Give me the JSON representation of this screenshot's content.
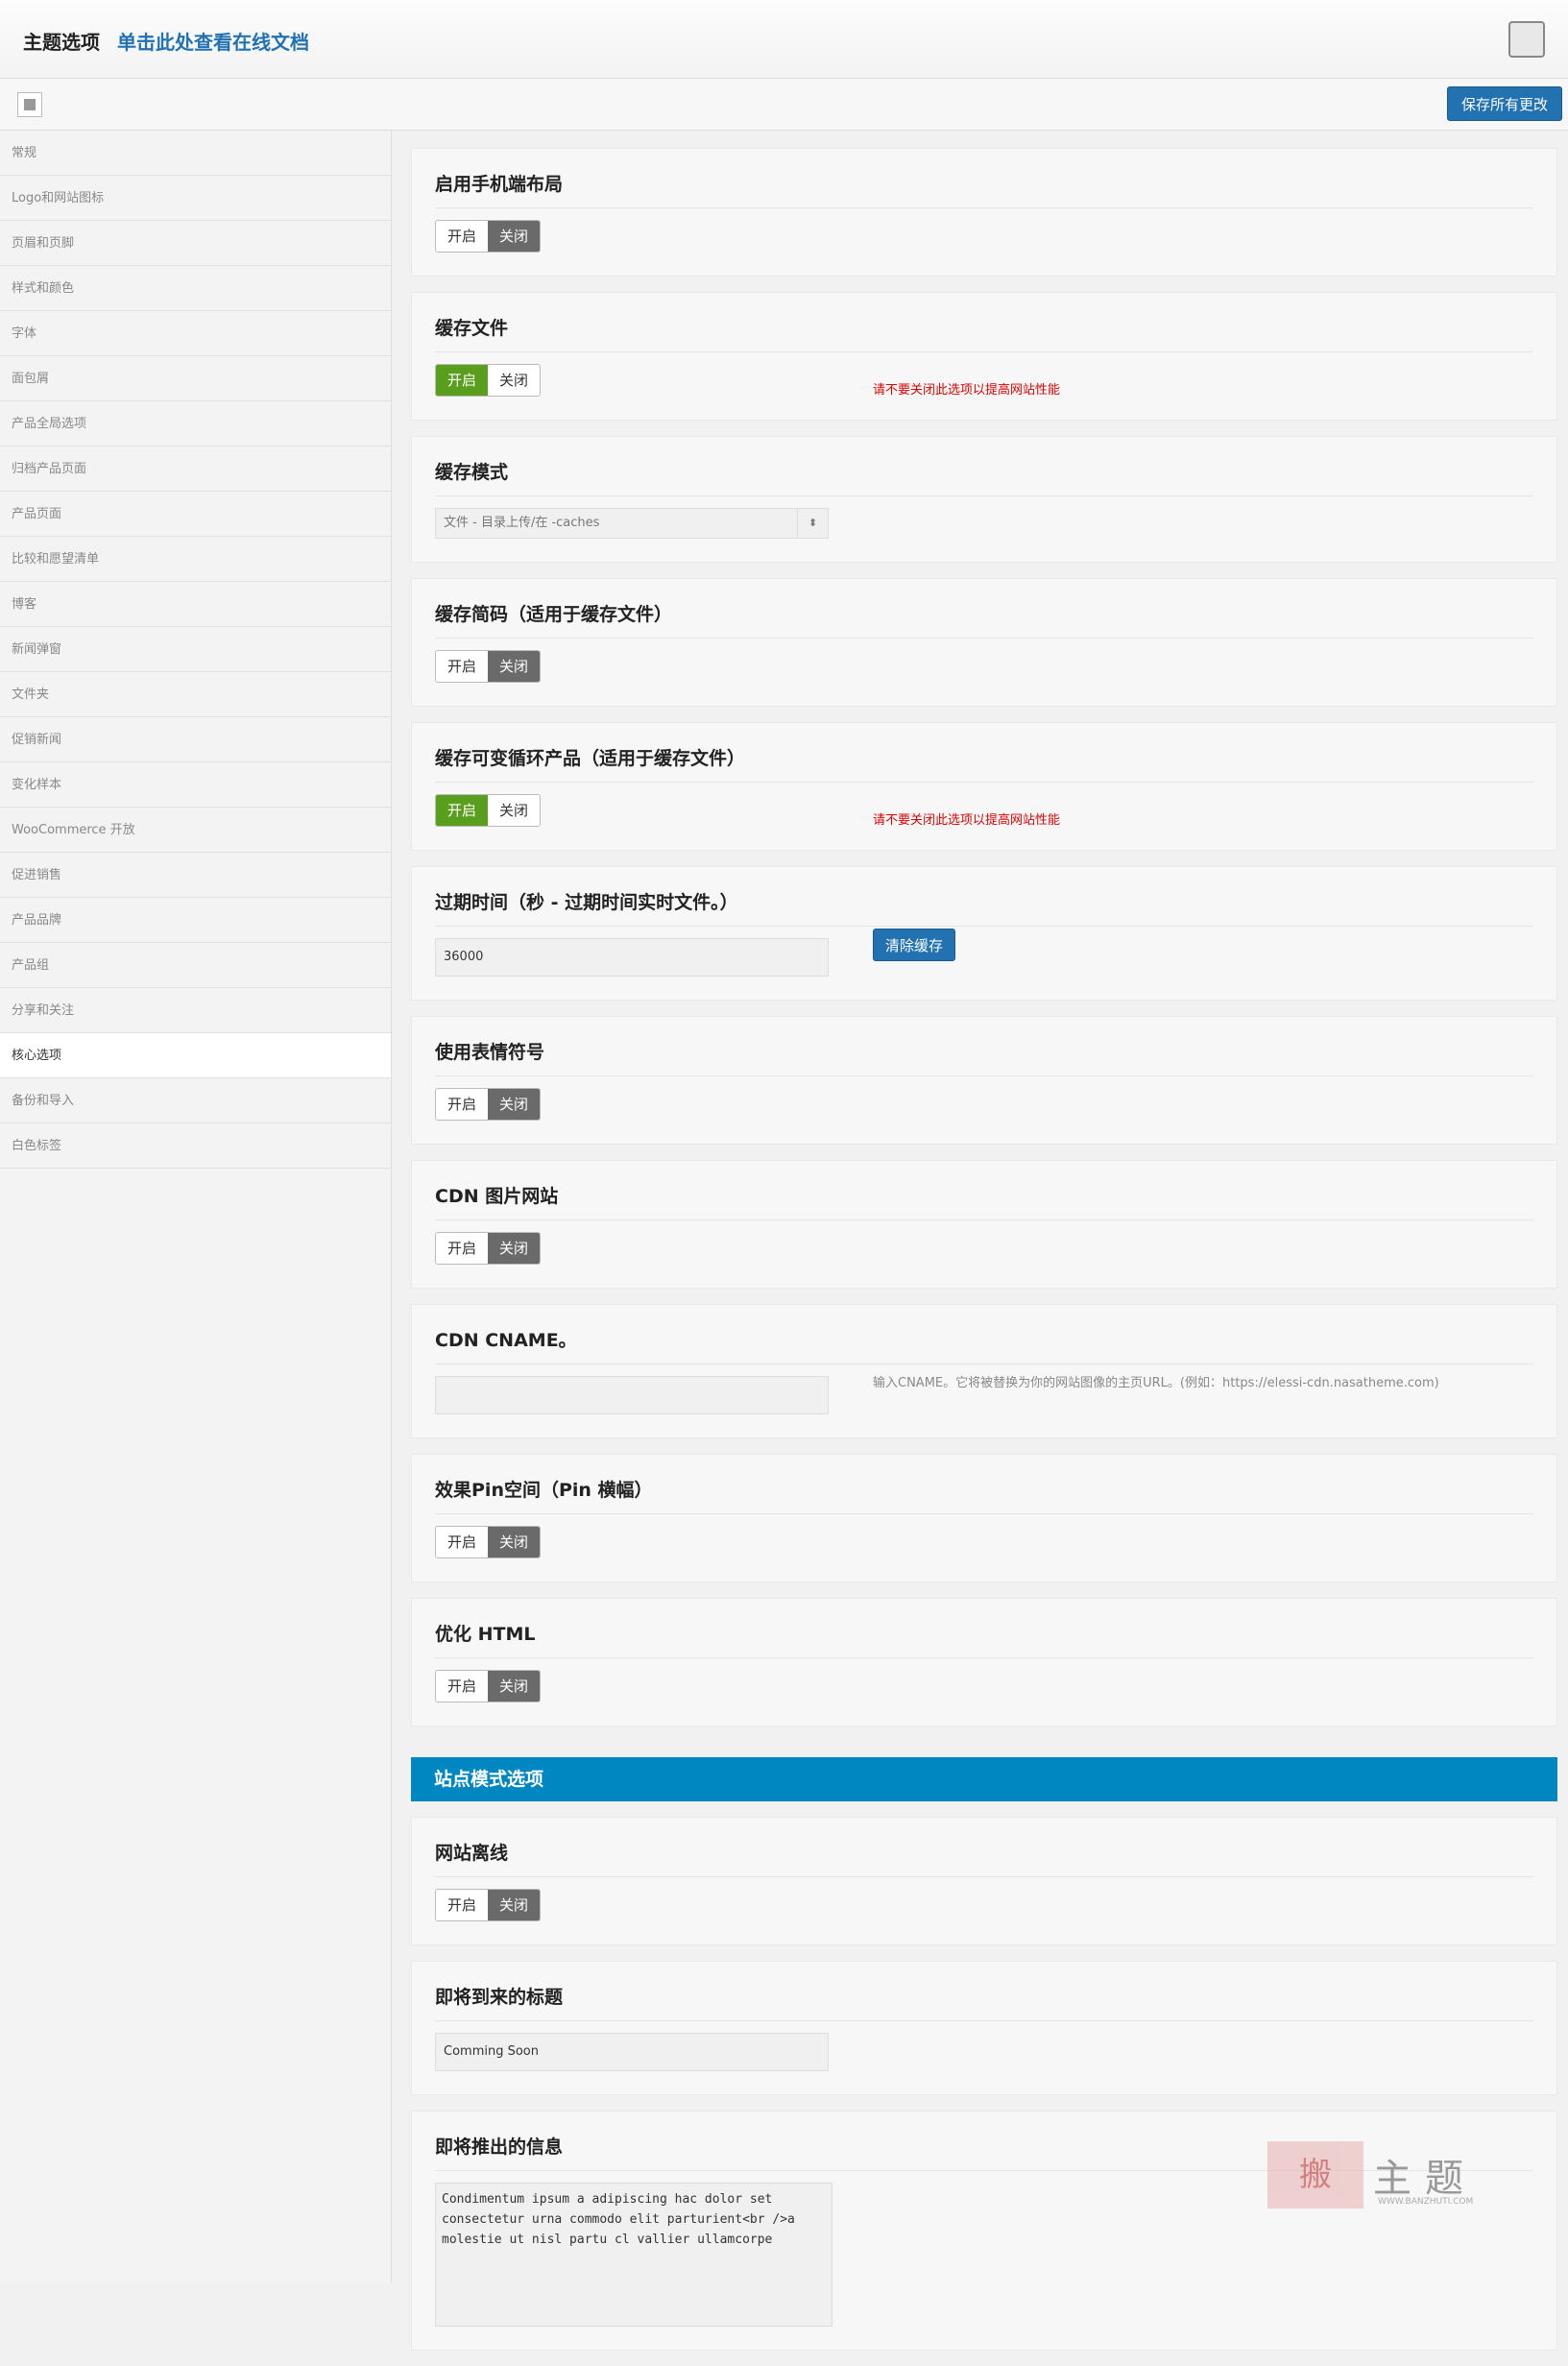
{
  "header": {
    "title": "主题选项",
    "doc_link": "单击此处查看在线文档"
  },
  "toolbar": {
    "save_label": "保存所有更改"
  },
  "sidebar": {
    "items": [
      "常规",
      "Logo和网站图标",
      "页眉和页脚",
      "样式和颜色",
      "字体",
      "面包屑",
      "产品全局选项",
      "归档产品页面",
      "产品页面",
      "比较和愿望清单",
      "博客",
      "新闻弹窗",
      "文件夹",
      "促销新闻",
      "变化样本",
      "WooCommerce 开放",
      "促进销售",
      "产品品牌",
      "产品组",
      "分享和关注",
      "核心选项",
      "备份和导入",
      "白色标签"
    ],
    "active_index": 20
  },
  "toggle_labels": {
    "on": "开启",
    "off": "关闭"
  },
  "sections": {
    "mobile_layout": {
      "title": "启用手机端布局",
      "state": "off"
    },
    "cache_file": {
      "title": "缓存文件",
      "state": "on",
      "warning": "请不要关闭此选项以提高网站性能"
    },
    "cache_mode": {
      "title": "缓存模式",
      "value": "文件 - 目录上传/在 -caches"
    },
    "cache_shortcode": {
      "title": "缓存简码（适用于缓存文件）",
      "state": "off"
    },
    "cache_variable": {
      "title": "缓存可变循环产品（适用于缓存文件）",
      "state": "on",
      "warning": "请不要关闭此选项以提高网站性能"
    },
    "expire_time": {
      "title": "过期时间（秒 - 过期时间实时文件。）",
      "value": "36000",
      "button": "清除缓存"
    },
    "emoji": {
      "title": "使用表情符号",
      "state": "off"
    },
    "cdn_images": {
      "title": "CDN 图片网站",
      "state": "off"
    },
    "cdn_cname": {
      "title": "CDN CNAME。",
      "value": "",
      "hint": "输入CNAME。它将被替换为你的网站图像的主页URL。(例如：https://elessi-cdn.nasatheme.com)"
    },
    "pin_space": {
      "title": "效果Pin空间（Pin 横幅）",
      "state": "off"
    },
    "optimize_html": {
      "title": "优化 HTML",
      "state": "off"
    }
  },
  "site_mode": {
    "banner": "站点模式选项",
    "offline": {
      "title": "网站离线",
      "state": "off"
    },
    "coming_title": {
      "title": "即将到来的标题",
      "value": "Comming Soon"
    },
    "coming_message": {
      "title": "即将推出的信息",
      "value": "Condimentum ipsum a adipiscing hac dolor set\nconsectetur urna commodo elit parturient<br />a\nmolestie ut nisl partu cl vallier ullamcorpe"
    }
  },
  "watermark": {
    "stamp": "搬",
    "text": "主题",
    "sub": "WWW.BANZHUTI.COM"
  }
}
